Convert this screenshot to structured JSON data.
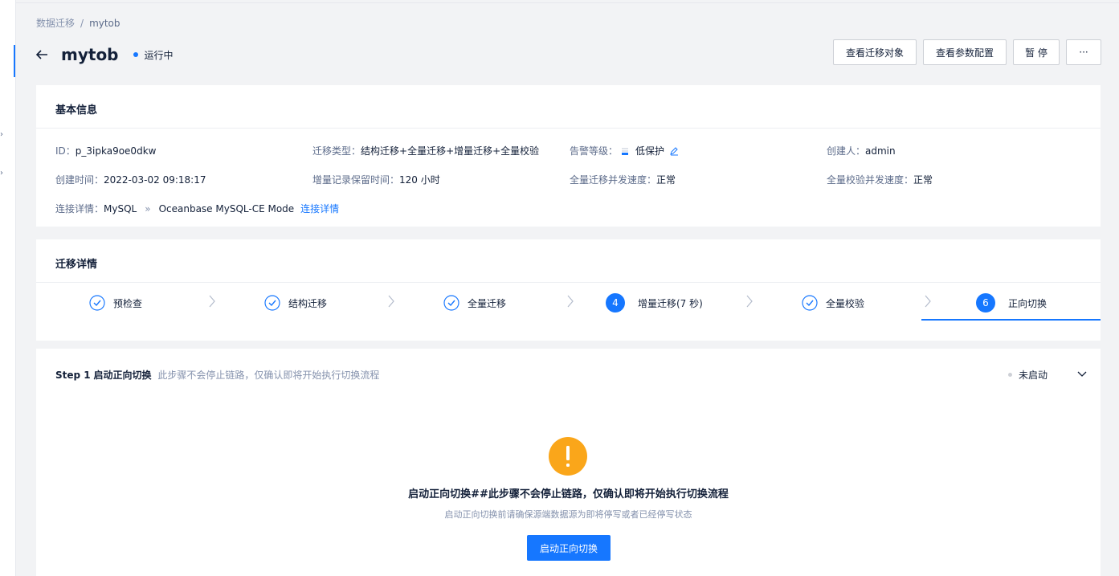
{
  "breadcrumb": {
    "root": "数据迁移",
    "separator": "/",
    "current": "mytob"
  },
  "header": {
    "title": "mytob",
    "status": "运行中"
  },
  "actions": {
    "view_objects": "查看迁移对象",
    "view_params": "查看参数配置",
    "pause": "暂 停",
    "more": "···"
  },
  "basic_info": {
    "title": "基本信息",
    "id_label": "ID：",
    "id_value": "p_3ipka9oe0dkw",
    "type_label": "迁移类型：",
    "type_value": "结构迁移+全量迁移+增量迁移+全量校验",
    "alarm_label": "告警等级：",
    "alarm_value": "低保护",
    "creator_label": "创建人：",
    "creator_value": "admin",
    "created_label": "创建时间：",
    "created_value": "2022-03-02 09:18:17",
    "retention_label": "增量记录保留时间：",
    "retention_value": "120 小时",
    "full_speed_label": "全量迁移并发速度：",
    "full_speed_value": "正常",
    "verify_speed_label": "全量校验并发速度：",
    "verify_speed_value": "正常",
    "conn_label": "连接详情：",
    "conn_source": "MySQL",
    "conn_sep": "»",
    "conn_target": "Oceanbase MySQL-CE Mode",
    "conn_link": "连接详情"
  },
  "migration_detail": {
    "title": "迁移详情",
    "steps": [
      {
        "label": "预检查",
        "state": "done"
      },
      {
        "label": "结构迁移",
        "state": "done"
      },
      {
        "label": "全量迁移",
        "state": "done"
      },
      {
        "label": "增量迁移(7 秒)",
        "state": "running",
        "number": "4"
      },
      {
        "label": "全量校验",
        "state": "done"
      },
      {
        "label": "正向切换",
        "state": "active",
        "number": "6"
      }
    ]
  },
  "step_panel": {
    "step_no": "Step 1",
    "step_title": "启动正向切换",
    "step_desc": "此步骤不会停止链路，仅确认即将开始执行切换流程",
    "status": "未启动",
    "result_title": "启动正向切换##此步骤不会停止链路，仅确认即将开始执行切换流程",
    "result_sub": "启动正向切换前请确保源端数据源为即将停写或者已经停写状态",
    "start_button": "启动正向切换"
  },
  "colors": {
    "primary": "#1677ff",
    "warning": "#faa61a",
    "text": "#132039",
    "muted": "#8592ad"
  }
}
